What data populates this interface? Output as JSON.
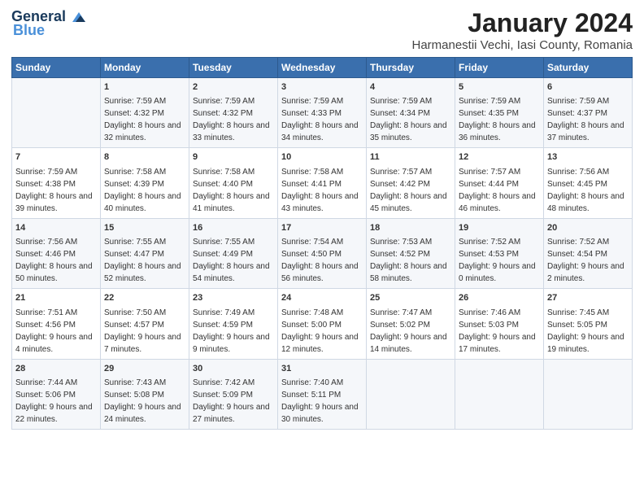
{
  "logo": {
    "line1": "General",
    "line2": "Blue"
  },
  "title": "January 2024",
  "subtitle": "Harmanestii Vechi, Iasi County, Romania",
  "days_of_week": [
    "Sunday",
    "Monday",
    "Tuesday",
    "Wednesday",
    "Thursday",
    "Friday",
    "Saturday"
  ],
  "weeks": [
    [
      {
        "day": "",
        "sunrise": "",
        "sunset": "",
        "daylight": ""
      },
      {
        "day": "1",
        "sunrise": "Sunrise: 7:59 AM",
        "sunset": "Sunset: 4:32 PM",
        "daylight": "Daylight: 8 hours and 32 minutes."
      },
      {
        "day": "2",
        "sunrise": "Sunrise: 7:59 AM",
        "sunset": "Sunset: 4:32 PM",
        "daylight": "Daylight: 8 hours and 33 minutes."
      },
      {
        "day": "3",
        "sunrise": "Sunrise: 7:59 AM",
        "sunset": "Sunset: 4:33 PM",
        "daylight": "Daylight: 8 hours and 34 minutes."
      },
      {
        "day": "4",
        "sunrise": "Sunrise: 7:59 AM",
        "sunset": "Sunset: 4:34 PM",
        "daylight": "Daylight: 8 hours and 35 minutes."
      },
      {
        "day": "5",
        "sunrise": "Sunrise: 7:59 AM",
        "sunset": "Sunset: 4:35 PM",
        "daylight": "Daylight: 8 hours and 36 minutes."
      },
      {
        "day": "6",
        "sunrise": "Sunrise: 7:59 AM",
        "sunset": "Sunset: 4:37 PM",
        "daylight": "Daylight: 8 hours and 37 minutes."
      }
    ],
    [
      {
        "day": "7",
        "sunrise": "Sunrise: 7:59 AM",
        "sunset": "Sunset: 4:38 PM",
        "daylight": "Daylight: 8 hours and 39 minutes."
      },
      {
        "day": "8",
        "sunrise": "Sunrise: 7:58 AM",
        "sunset": "Sunset: 4:39 PM",
        "daylight": "Daylight: 8 hours and 40 minutes."
      },
      {
        "day": "9",
        "sunrise": "Sunrise: 7:58 AM",
        "sunset": "Sunset: 4:40 PM",
        "daylight": "Daylight: 8 hours and 41 minutes."
      },
      {
        "day": "10",
        "sunrise": "Sunrise: 7:58 AM",
        "sunset": "Sunset: 4:41 PM",
        "daylight": "Daylight: 8 hours and 43 minutes."
      },
      {
        "day": "11",
        "sunrise": "Sunrise: 7:57 AM",
        "sunset": "Sunset: 4:42 PM",
        "daylight": "Daylight: 8 hours and 45 minutes."
      },
      {
        "day": "12",
        "sunrise": "Sunrise: 7:57 AM",
        "sunset": "Sunset: 4:44 PM",
        "daylight": "Daylight: 8 hours and 46 minutes."
      },
      {
        "day": "13",
        "sunrise": "Sunrise: 7:56 AM",
        "sunset": "Sunset: 4:45 PM",
        "daylight": "Daylight: 8 hours and 48 minutes."
      }
    ],
    [
      {
        "day": "14",
        "sunrise": "Sunrise: 7:56 AM",
        "sunset": "Sunset: 4:46 PM",
        "daylight": "Daylight: 8 hours and 50 minutes."
      },
      {
        "day": "15",
        "sunrise": "Sunrise: 7:55 AM",
        "sunset": "Sunset: 4:47 PM",
        "daylight": "Daylight: 8 hours and 52 minutes."
      },
      {
        "day": "16",
        "sunrise": "Sunrise: 7:55 AM",
        "sunset": "Sunset: 4:49 PM",
        "daylight": "Daylight: 8 hours and 54 minutes."
      },
      {
        "day": "17",
        "sunrise": "Sunrise: 7:54 AM",
        "sunset": "Sunset: 4:50 PM",
        "daylight": "Daylight: 8 hours and 56 minutes."
      },
      {
        "day": "18",
        "sunrise": "Sunrise: 7:53 AM",
        "sunset": "Sunset: 4:52 PM",
        "daylight": "Daylight: 8 hours and 58 minutes."
      },
      {
        "day": "19",
        "sunrise": "Sunrise: 7:52 AM",
        "sunset": "Sunset: 4:53 PM",
        "daylight": "Daylight: 9 hours and 0 minutes."
      },
      {
        "day": "20",
        "sunrise": "Sunrise: 7:52 AM",
        "sunset": "Sunset: 4:54 PM",
        "daylight": "Daylight: 9 hours and 2 minutes."
      }
    ],
    [
      {
        "day": "21",
        "sunrise": "Sunrise: 7:51 AM",
        "sunset": "Sunset: 4:56 PM",
        "daylight": "Daylight: 9 hours and 4 minutes."
      },
      {
        "day": "22",
        "sunrise": "Sunrise: 7:50 AM",
        "sunset": "Sunset: 4:57 PM",
        "daylight": "Daylight: 9 hours and 7 minutes."
      },
      {
        "day": "23",
        "sunrise": "Sunrise: 7:49 AM",
        "sunset": "Sunset: 4:59 PM",
        "daylight": "Daylight: 9 hours and 9 minutes."
      },
      {
        "day": "24",
        "sunrise": "Sunrise: 7:48 AM",
        "sunset": "Sunset: 5:00 PM",
        "daylight": "Daylight: 9 hours and 12 minutes."
      },
      {
        "day": "25",
        "sunrise": "Sunrise: 7:47 AM",
        "sunset": "Sunset: 5:02 PM",
        "daylight": "Daylight: 9 hours and 14 minutes."
      },
      {
        "day": "26",
        "sunrise": "Sunrise: 7:46 AM",
        "sunset": "Sunset: 5:03 PM",
        "daylight": "Daylight: 9 hours and 17 minutes."
      },
      {
        "day": "27",
        "sunrise": "Sunrise: 7:45 AM",
        "sunset": "Sunset: 5:05 PM",
        "daylight": "Daylight: 9 hours and 19 minutes."
      }
    ],
    [
      {
        "day": "28",
        "sunrise": "Sunrise: 7:44 AM",
        "sunset": "Sunset: 5:06 PM",
        "daylight": "Daylight: 9 hours and 22 minutes."
      },
      {
        "day": "29",
        "sunrise": "Sunrise: 7:43 AM",
        "sunset": "Sunset: 5:08 PM",
        "daylight": "Daylight: 9 hours and 24 minutes."
      },
      {
        "day": "30",
        "sunrise": "Sunrise: 7:42 AM",
        "sunset": "Sunset: 5:09 PM",
        "daylight": "Daylight: 9 hours and 27 minutes."
      },
      {
        "day": "31",
        "sunrise": "Sunrise: 7:40 AM",
        "sunset": "Sunset: 5:11 PM",
        "daylight": "Daylight: 9 hours and 30 minutes."
      },
      {
        "day": "",
        "sunrise": "",
        "sunset": "",
        "daylight": ""
      },
      {
        "day": "",
        "sunrise": "",
        "sunset": "",
        "daylight": ""
      },
      {
        "day": "",
        "sunrise": "",
        "sunset": "",
        "daylight": ""
      }
    ]
  ]
}
